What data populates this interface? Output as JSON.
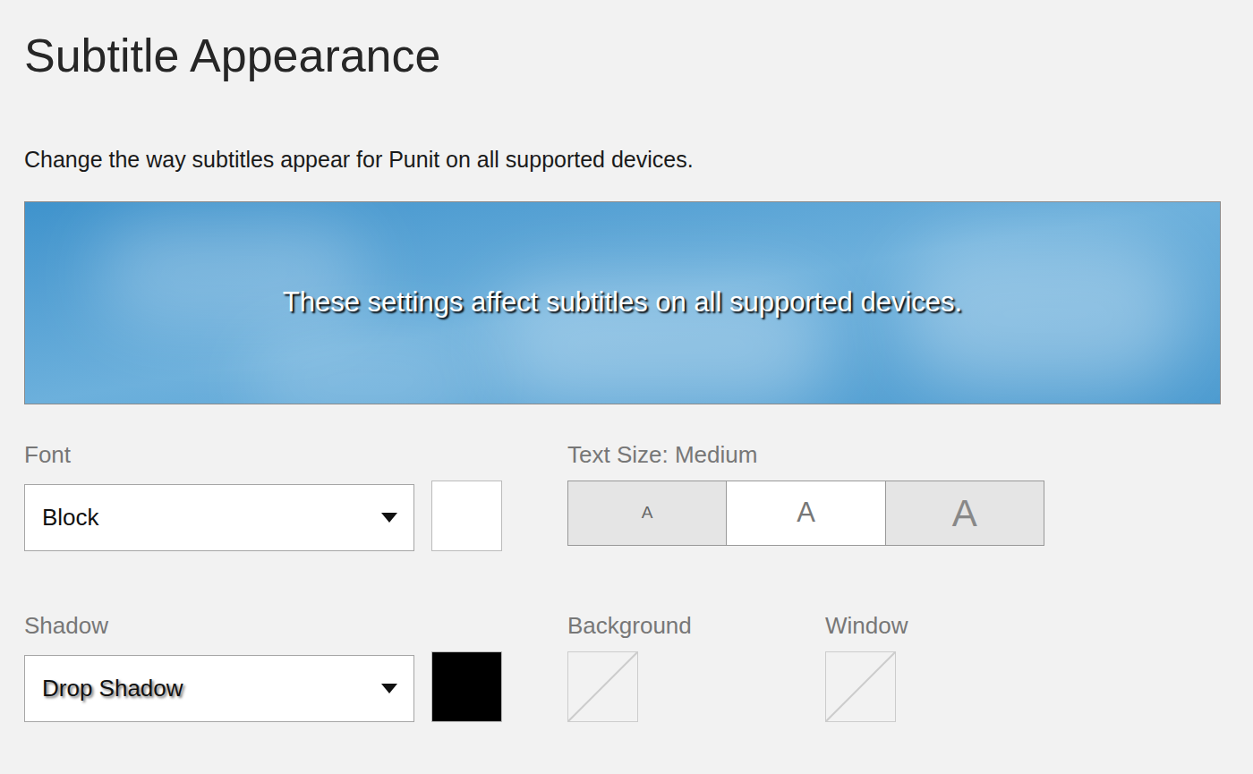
{
  "title": "Subtitle Appearance",
  "description": "Change the way subtitles appear for Punit on all supported devices.",
  "preview": {
    "text": "These settings affect subtitles on all supported devices."
  },
  "font": {
    "label": "Font",
    "value": "Block",
    "color": "#ffffff"
  },
  "text_size": {
    "label": "Text Size: Medium",
    "options": [
      {
        "label": "A",
        "kind": "small",
        "selected": false
      },
      {
        "label": "A",
        "kind": "medium",
        "selected": true
      },
      {
        "label": "A",
        "kind": "large",
        "selected": false
      }
    ]
  },
  "shadow": {
    "label": "Shadow",
    "value": "Drop Shadow",
    "color": "#000000"
  },
  "background": {
    "label": "Background",
    "set": false
  },
  "window": {
    "label": "Window",
    "set": false
  }
}
